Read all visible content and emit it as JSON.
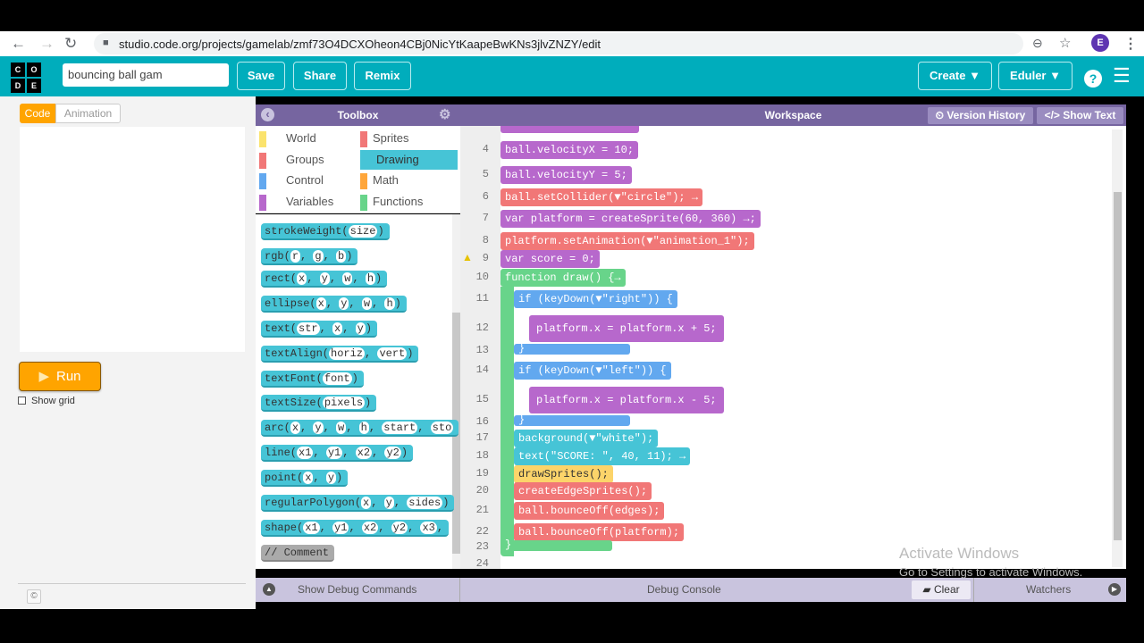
{
  "browser": {
    "url": "studio.code.org/projects/gamelab/zmf73O4DCXOheon4CBj0NicYtKaapeBwKNs3jlvZNZY/edit",
    "back_icon": "←",
    "forward_icon": "→",
    "reload_icon": "↻",
    "lock_icon": "🔒",
    "zoom_icon": "⊖",
    "star_icon": "☆",
    "avatar_letter": "E",
    "menu_icon": "⋮"
  },
  "header": {
    "logo_letters": [
      "C",
      "O",
      "D",
      "E"
    ],
    "project_name": "bouncing ball gam",
    "save": "Save",
    "share": "Share",
    "remix": "Remix",
    "create": "Create ▼",
    "user": "Eduler ▼",
    "help_icon": "?",
    "menu_icon": "☰"
  },
  "left": {
    "tab_code": "Code",
    "tab_animation": "Animation",
    "run": "Run",
    "show_grid": "Show grid",
    "copyright_icon": "©"
  },
  "toolbox": {
    "title": "Toolbox",
    "collapse_icon": "‹",
    "gear_icon": "⚙",
    "categories": [
      {
        "label": "World",
        "color": "#fbe36d"
      },
      {
        "label": "Sprites",
        "color": "#f17777"
      },
      {
        "label": "Groups",
        "color": "#f17777"
      },
      {
        "label": "Drawing",
        "color": "#46c4d6",
        "selected": true
      },
      {
        "label": "Control",
        "color": "#62a8ef"
      },
      {
        "label": "Math",
        "color": "#ffa63b"
      },
      {
        "label": "Variables",
        "color": "#b768cc"
      },
      {
        "label": "Functions",
        "color": "#68d48a"
      }
    ],
    "blocks": [
      {
        "name": "strokeWeight",
        "args": [
          "size"
        ]
      },
      {
        "name": "rgb",
        "args": [
          "r",
          "g",
          "b"
        ]
      },
      {
        "name": "rect",
        "args": [
          "x",
          "y",
          "w",
          "h"
        ]
      },
      {
        "name": "ellipse",
        "args": [
          "x",
          "y",
          "w",
          "h"
        ]
      },
      {
        "name": "text",
        "args": [
          "str",
          "x",
          "y"
        ]
      },
      {
        "name": "textAlign",
        "args": [
          "horiz",
          "vert"
        ]
      },
      {
        "name": "textFont",
        "args": [
          "font"
        ]
      },
      {
        "name": "textSize",
        "args": [
          "pixels"
        ]
      },
      {
        "name": "arc",
        "args": [
          "x",
          "y",
          "w",
          "h",
          "start",
          "sto"
        ]
      },
      {
        "name": "line",
        "args": [
          "x1",
          "y1",
          "x2",
          "y2"
        ]
      },
      {
        "name": "point",
        "args": [
          "x",
          "y"
        ]
      },
      {
        "name": "regularPolygon",
        "args": [
          "x",
          "y",
          "sides"
        ]
      },
      {
        "name": "shape",
        "args": [
          "x1",
          "y1",
          "x2",
          "y2",
          "x3",
          ""
        ]
      }
    ],
    "comment": "// Comment"
  },
  "workspace": {
    "title": "Workspace",
    "version_history": "⏲ Version History",
    "show_text": "</> Show Text",
    "lines": [
      {
        "n": "4",
        "code": "ball.velocityX = 10;"
      },
      {
        "n": "5",
        "code": "ball.velocityY = 5;"
      },
      {
        "n": "6",
        "code": "ball.setCollider(▼\"circle\"); →"
      },
      {
        "n": "7",
        "code": "var platform = createSprite(60, 360) →;"
      },
      {
        "n": "8",
        "code": "platform.setAnimation(▼\"animation_1\");"
      },
      {
        "n": "9",
        "code": "var score = 0;",
        "warning": true
      },
      {
        "n": "10",
        "code": "function draw() {→"
      },
      {
        "n": "11",
        "code": "if (keyDown(▼\"right\")) {"
      },
      {
        "n": "12",
        "code": "platform.x = platform.x + 5;"
      },
      {
        "n": "13",
        "code": "}"
      },
      {
        "n": "14",
        "code": "if (keyDown(▼\"left\")) {"
      },
      {
        "n": "15",
        "code": "platform.x = platform.x - 5;"
      },
      {
        "n": "16",
        "code": "}"
      },
      {
        "n": "17",
        "code": "background(▼\"white\");"
      },
      {
        "n": "18",
        "code": "text(\"SCORE: \", 40, 11); →"
      },
      {
        "n": "19",
        "code": "drawSprites();"
      },
      {
        "n": "20",
        "code": "createEdgeSprites();"
      },
      {
        "n": "21",
        "code": "ball.bounceOff(edges);"
      },
      {
        "n": "22",
        "code": "ball.bounceOff(platform);"
      },
      {
        "n": "23",
        "code": "}"
      },
      {
        "n": "24",
        "code": ""
      }
    ]
  },
  "debug": {
    "show_commands": "Show Debug Commands",
    "console": "Debug Console",
    "clear": "Clear",
    "watchers": "Watchers"
  },
  "watermark": {
    "line1": "Activate Windows",
    "line2": "Go to Settings to activate Windows."
  }
}
